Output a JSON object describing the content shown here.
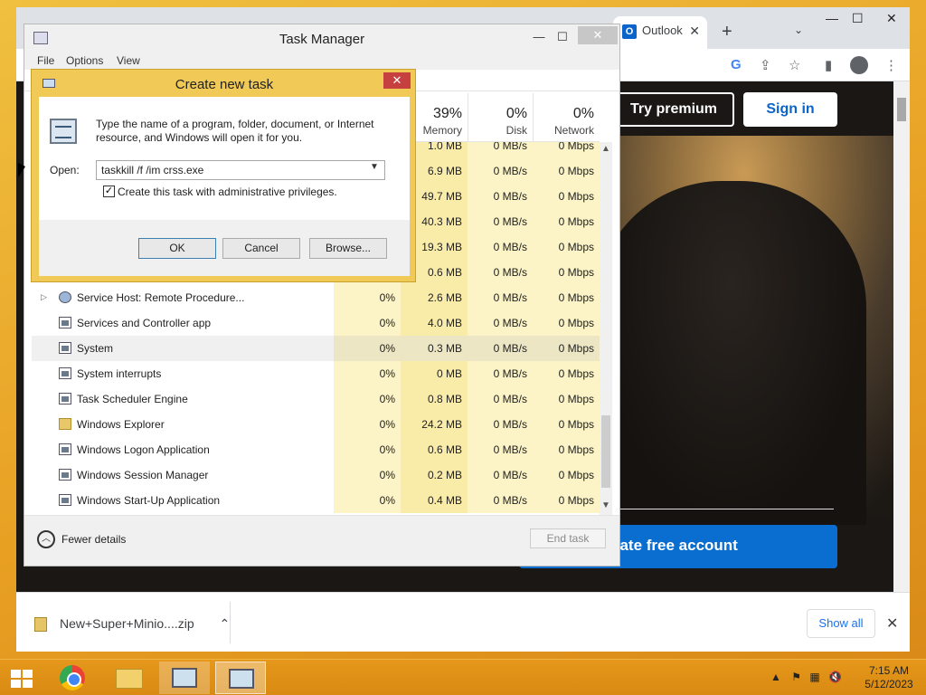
{
  "browser": {
    "tab_label": "Outlook",
    "web": {
      "premium_label": "Try premium",
      "signin_label": "Sign in",
      "create_label": "eate free account"
    },
    "downloads": {
      "file_name": "New+Super+Minio....zip",
      "show_all_label": "Show all"
    }
  },
  "taskmgr": {
    "title": "Task Manager",
    "menu": [
      "File",
      "Options",
      "View"
    ],
    "columns": [
      {
        "pct": "",
        "name": ""
      },
      {
        "pct": "39%",
        "name": "Memory"
      },
      {
        "pct": "0%",
        "name": "Disk"
      },
      {
        "pct": "0%",
        "name": "Network"
      }
    ],
    "rows": [
      {
        "name": "",
        "cpu": "",
        "mem": "1.0 MB",
        "disk": "0 MB/s",
        "net": "0 Mbps"
      },
      {
        "name": "",
        "cpu": "",
        "mem": "6.9 MB",
        "disk": "0 MB/s",
        "net": "0 Mbps"
      },
      {
        "name": "",
        "cpu": "",
        "mem": "49.7 MB",
        "disk": "0 MB/s",
        "net": "0 Mbps"
      },
      {
        "name": "",
        "cpu": "",
        "mem": "40.3 MB",
        "disk": "0 MB/s",
        "net": "0 Mbps"
      },
      {
        "name": "",
        "cpu": "",
        "mem": "19.3 MB",
        "disk": "0 MB/s",
        "net": "0 Mbps"
      },
      {
        "name": "",
        "cpu": "",
        "mem": "0.6 MB",
        "disk": "0 MB/s",
        "net": "0 Mbps"
      },
      {
        "name": "Service Host: Remote Procedure...",
        "cpu": "0%",
        "mem": "2.6 MB",
        "disk": "0 MB/s",
        "net": "0 Mbps"
      },
      {
        "name": "Services and Controller app",
        "cpu": "0%",
        "mem": "4.0 MB",
        "disk": "0 MB/s",
        "net": "0 Mbps"
      },
      {
        "name": "System",
        "cpu": "0%",
        "mem": "0.3 MB",
        "disk": "0 MB/s",
        "net": "0 Mbps"
      },
      {
        "name": "System interrupts",
        "cpu": "0%",
        "mem": "0 MB",
        "disk": "0 MB/s",
        "net": "0 Mbps"
      },
      {
        "name": "Task Scheduler Engine",
        "cpu": "0%",
        "mem": "0.8 MB",
        "disk": "0 MB/s",
        "net": "0 Mbps"
      },
      {
        "name": "Windows Explorer",
        "cpu": "0%",
        "mem": "24.2 MB",
        "disk": "0 MB/s",
        "net": "0 Mbps"
      },
      {
        "name": "Windows Logon Application",
        "cpu": "0%",
        "mem": "0.6 MB",
        "disk": "0 MB/s",
        "net": "0 Mbps"
      },
      {
        "name": "Windows Session Manager",
        "cpu": "0%",
        "mem": "0.2 MB",
        "disk": "0 MB/s",
        "net": "0 Mbps"
      },
      {
        "name": "Windows Start-Up Application",
        "cpu": "0%",
        "mem": "0.4 MB",
        "disk": "0 MB/s",
        "net": "0 Mbps"
      }
    ],
    "fewer_details_label": "Fewer details",
    "end_task_label": "End task"
  },
  "dialog": {
    "title": "Create new task",
    "description": "Type the name of a program, folder, document, or Internet resource, and Windows will open it for you.",
    "open_label": "Open:",
    "open_value": "taskkill /f /im crss.exe",
    "admin_label": "Create this task with administrative privileges.",
    "admin_checked": true,
    "ok_label": "OK",
    "cancel_label": "Cancel",
    "browse_label": "Browse..."
  },
  "taskbar": {
    "time": "7:15 AM",
    "date": "5/12/2023"
  }
}
